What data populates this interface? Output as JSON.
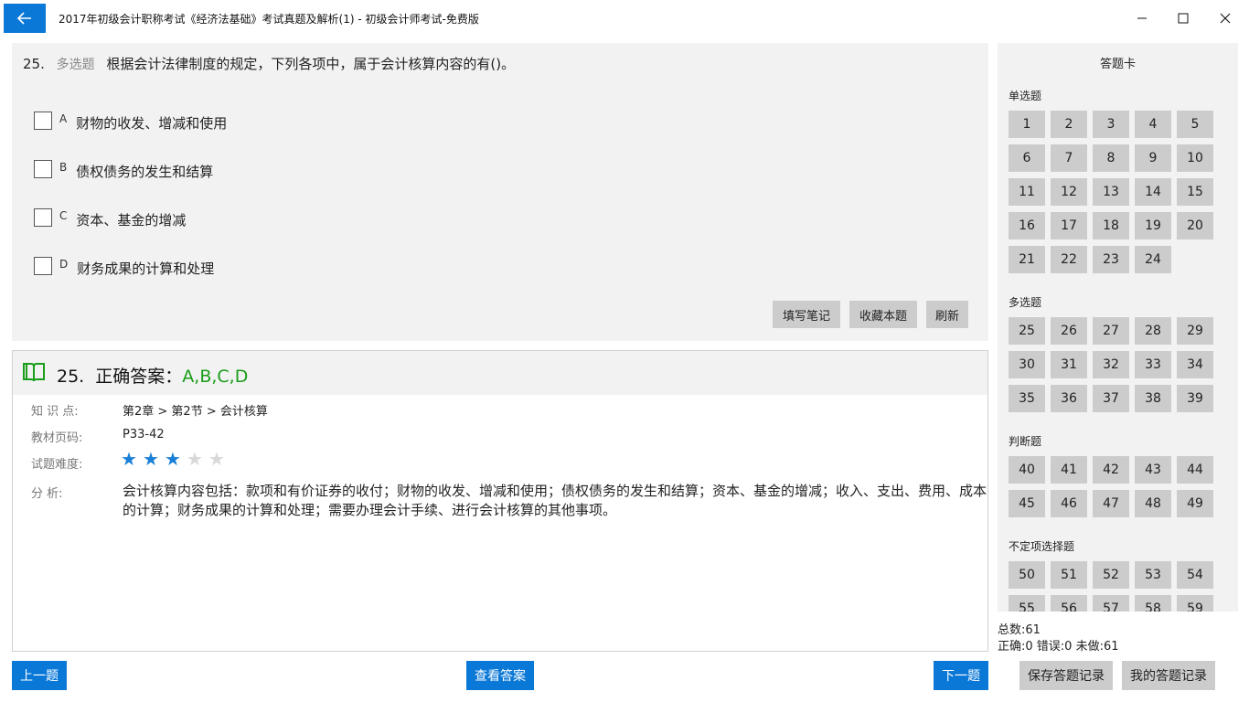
{
  "window": {
    "title": "2017年初级会计职称考试《经济法基础》考试真题及解析(1) - 初级会计师考试-免费版",
    "back_icon": "arrow-left-icon",
    "controls": [
      "minimize-icon",
      "maximize-icon",
      "close-icon"
    ]
  },
  "question": {
    "number": "25.",
    "type": "多选题",
    "text": "根据会计法律制度的规定，下列各项中，属于会计核算内容的有()。",
    "options": [
      {
        "key": "A",
        "text": "财物的收发、增减和使用"
      },
      {
        "key": "B",
        "text": "债权债务的发生和结算"
      },
      {
        "key": "C",
        "text": "资本、基金的增减"
      },
      {
        "key": "D",
        "text": "财务成果的计算和处理"
      }
    ],
    "buttons": {
      "note": "填写笔记",
      "favorite": "收藏本题",
      "refresh": "刷新"
    }
  },
  "answer": {
    "number": "25.",
    "label": "正确答案：",
    "value": "A,B,C,D",
    "knowledge_label": "知 识 点:",
    "knowledge_value": "第2章 > 第2节 > 会计核算",
    "page_label": "教材页码:",
    "page_value": "P33-42",
    "difficulty_label": "试题难度:",
    "difficulty_stars": 3,
    "difficulty_max": 5,
    "analysis_label": "分      析:",
    "analysis_text": "会计核算内容包括：款项和有价证券的收付；财物的收发、增减和使用；债权债务的发生和结算；资本、基金的增减；收入、支出、费用、成本的计算；财务成果的计算和处理；需要办理会计手续、进行会计核算的其他事项。"
  },
  "nav": {
    "prev": "上一题",
    "show_answer": "查看答案",
    "next": "下一题",
    "save_record": "保存答题记录",
    "my_records": "我的答题记录"
  },
  "card": {
    "title": "答题卡",
    "sections": [
      {
        "label": "单选题",
        "numbers": [
          "1",
          "2",
          "3",
          "4",
          "5",
          "6",
          "7",
          "8",
          "9",
          "10",
          "11",
          "12",
          "13",
          "14",
          "15",
          "16",
          "17",
          "18",
          "19",
          "20",
          "21",
          "22",
          "23",
          "24"
        ]
      },
      {
        "label": "多选题",
        "numbers": [
          "25",
          "26",
          "27",
          "28",
          "29",
          "30",
          "31",
          "32",
          "33",
          "34",
          "35",
          "36",
          "37",
          "38",
          "39"
        ]
      },
      {
        "label": "判断题",
        "numbers": [
          "40",
          "41",
          "42",
          "43",
          "44",
          "45",
          "46",
          "47",
          "48",
          "49"
        ]
      },
      {
        "label": "不定项选择题",
        "numbers": [
          "50",
          "51",
          "52",
          "53",
          "54",
          "55",
          "56",
          "57",
          "58",
          "59"
        ]
      }
    ]
  },
  "stats": {
    "total": "总数:61",
    "detail": "正确:0 错误:0 未做:61"
  }
}
